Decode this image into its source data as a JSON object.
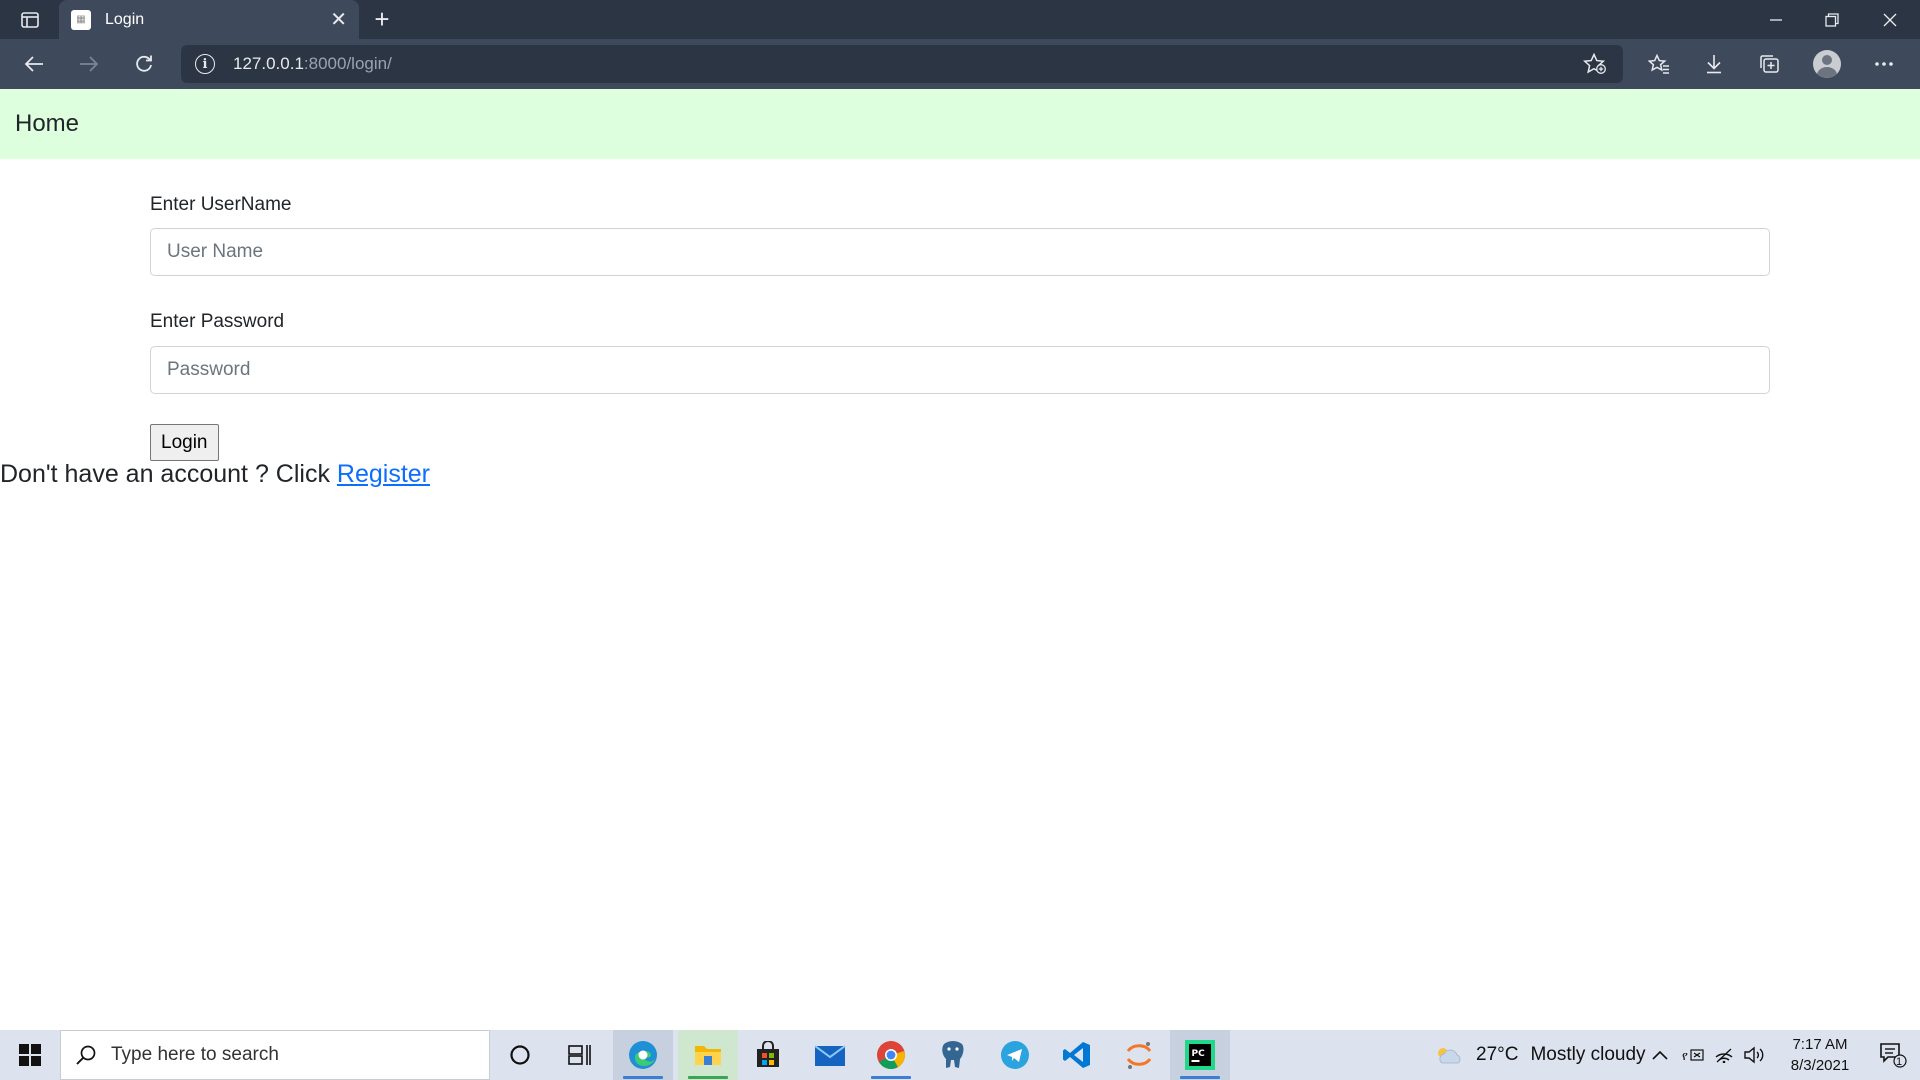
{
  "browser": {
    "tab_title": "Login",
    "tab_favicon": "page-favicon",
    "url_host": "127.0.0.1",
    "url_rest": ":8000/login/"
  },
  "page": {
    "brand": "Home",
    "username_label": "Enter UserName",
    "username_placeholder": "User Name",
    "password_label": "Enter Password",
    "password_placeholder": "Password",
    "login_button": "Login",
    "register_prompt": "Don't have an account ? Click ",
    "register_link": "Register"
  },
  "taskbar": {
    "search_placeholder": "Type here to search",
    "weather_temp": "27°C",
    "weather_desc": "Mostly cloudy",
    "time": "7:17 AM",
    "date": "8/3/2021",
    "notification_count": "1"
  },
  "colors": {
    "navbar_bg": "#ddffdd",
    "link": "#0d6efd",
    "chrome_dark": "#2b3544",
    "chrome_tab": "#3e4a5c",
    "taskbar_bg": "#dde3ee"
  }
}
